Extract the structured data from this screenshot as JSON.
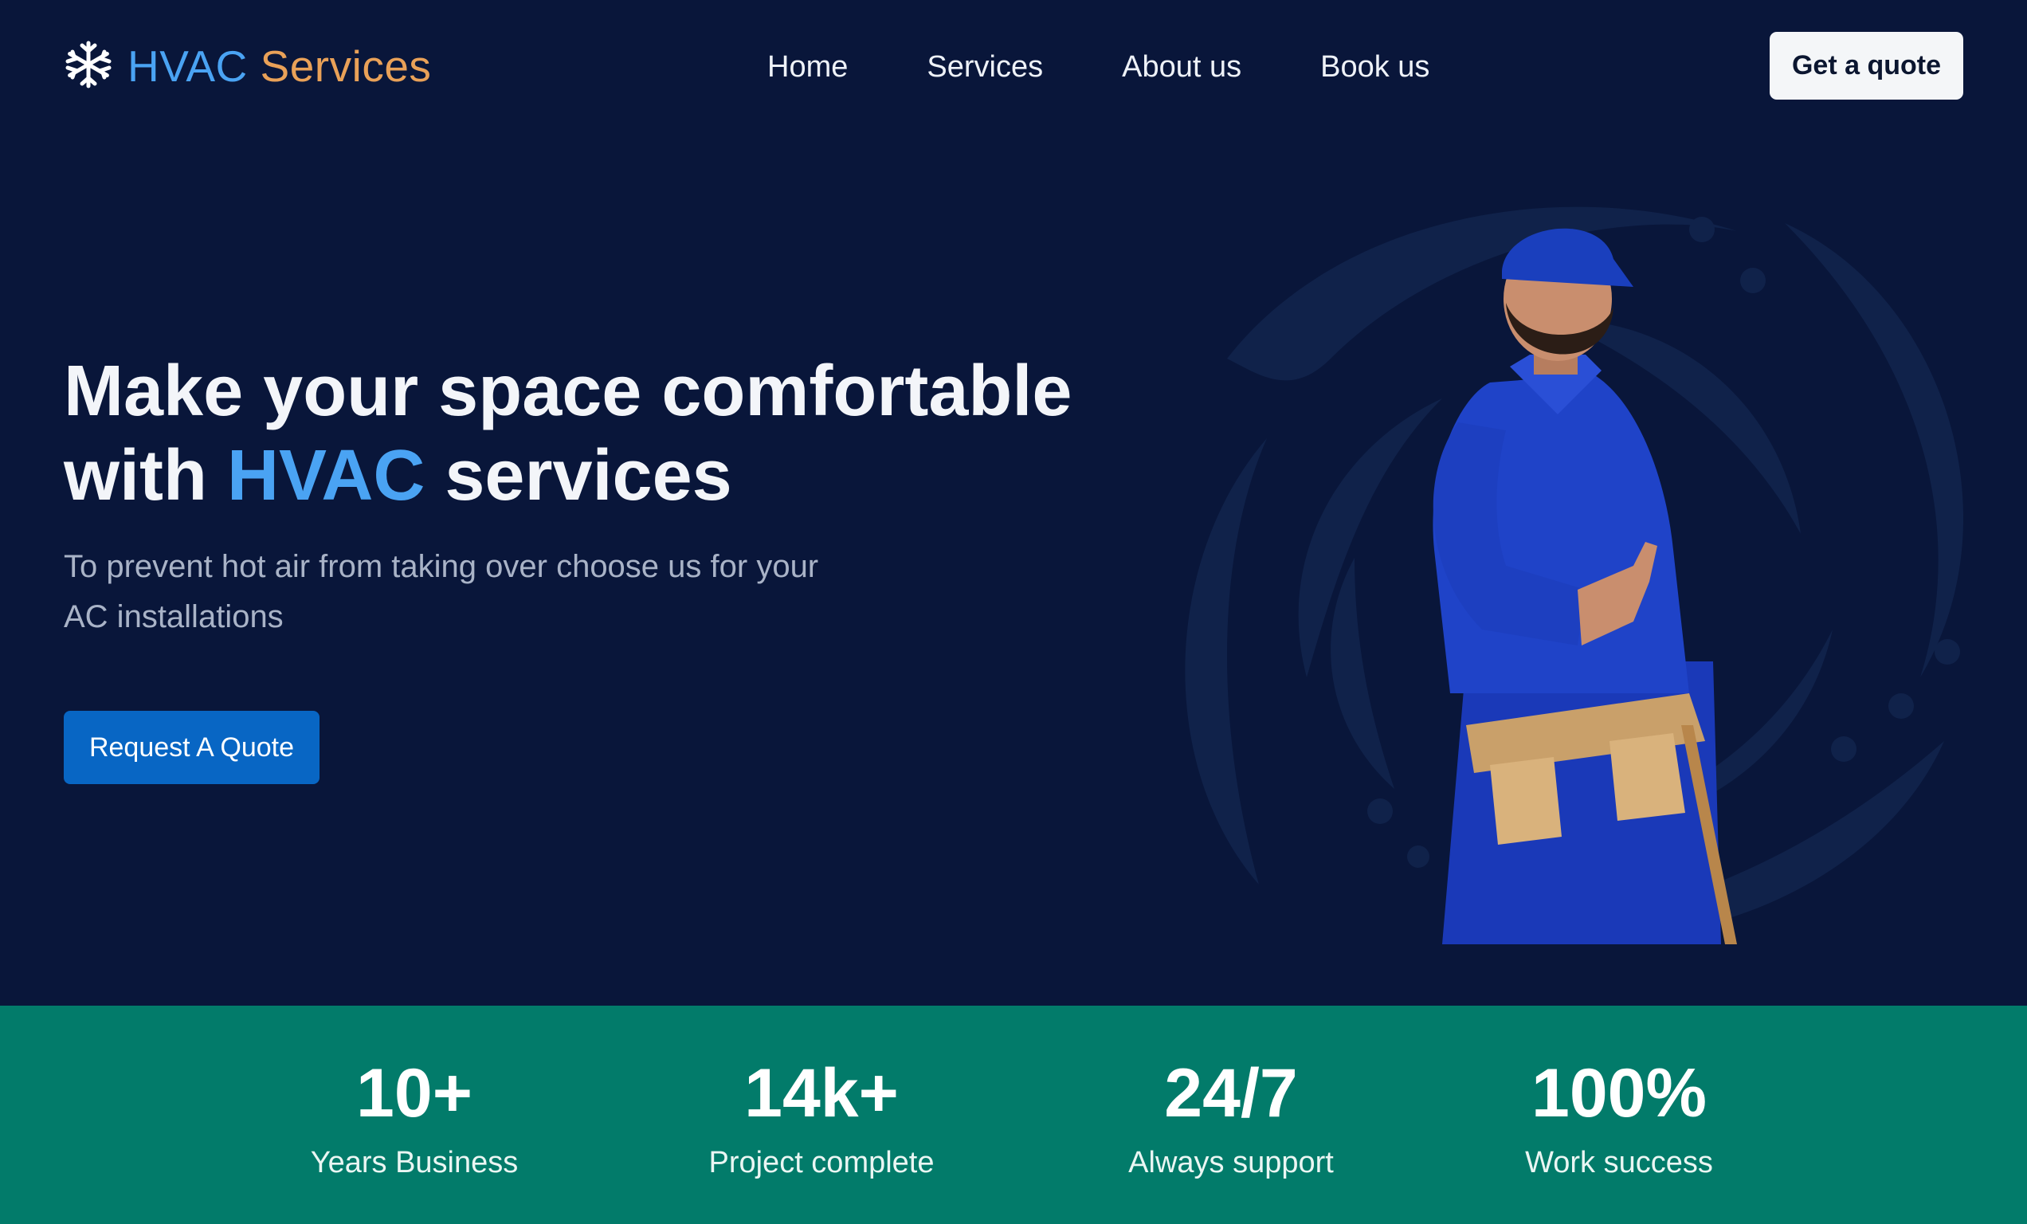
{
  "brand": {
    "name_part1": "HVAC",
    "name_part2": "Services",
    "icon": "snowflake-icon",
    "colors": {
      "part1": "#4aa3f3",
      "part2": "#e9a158"
    }
  },
  "nav": {
    "items": [
      {
        "label": "Home"
      },
      {
        "label": "Services"
      },
      {
        "label": "About us"
      },
      {
        "label": "Book us"
      }
    ],
    "cta_label": "Get a quote"
  },
  "hero": {
    "title_line1": "Make your space comfortable",
    "title_with": "with",
    "title_accent": "HVAC",
    "title_end": "services",
    "subtitle": "To prevent hot air from taking over choose us for your AC installations",
    "cta_label": "Request A Quote",
    "image": "technician-pointing-illustration"
  },
  "stats": [
    {
      "value": "10+",
      "label": "Years Business"
    },
    {
      "value": "14k+",
      "label": "Project complete"
    },
    {
      "value": "24/7",
      "label": "Always support"
    },
    {
      "value": "100%",
      "label": "Work success"
    }
  ],
  "colors": {
    "background": "#09163a",
    "accent": "#4aa3f3",
    "cta": "#0866c4",
    "stats_band": "#027b6a"
  }
}
